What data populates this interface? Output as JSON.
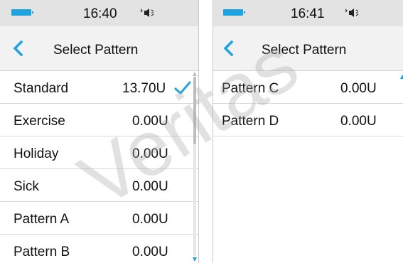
{
  "accent_color": "#1fa3e0",
  "left_screen": {
    "status_bar": {
      "time": "16:40",
      "battery_icon": "battery-icon",
      "sound_icon": "speaker-icon"
    },
    "title": "Select Pattern",
    "back_icon": "chevron-left-icon",
    "patterns": [
      {
        "name": "Standard",
        "value": "13.70U",
        "selected": true
      },
      {
        "name": "Exercise",
        "value": "0.00U",
        "selected": false
      },
      {
        "name": "Holiday",
        "value": "0.00U",
        "selected": false
      },
      {
        "name": "Sick",
        "value": "0.00U",
        "selected": false
      },
      {
        "name": "Pattern A",
        "value": "0.00U",
        "selected": false
      },
      {
        "name": "Pattern B",
        "value": "0.00U",
        "selected": false
      }
    ]
  },
  "right_screen": {
    "status_bar": {
      "time": "16:41",
      "battery_icon": "battery-icon",
      "sound_icon": "speaker-icon"
    },
    "title": "Select Pattern",
    "back_icon": "chevron-left-icon",
    "patterns": [
      {
        "name": "Pattern C",
        "value": "0.00U",
        "selected": false
      },
      {
        "name": "Pattern D",
        "value": "0.00U",
        "selected": false
      }
    ]
  },
  "watermark": "Veritas"
}
